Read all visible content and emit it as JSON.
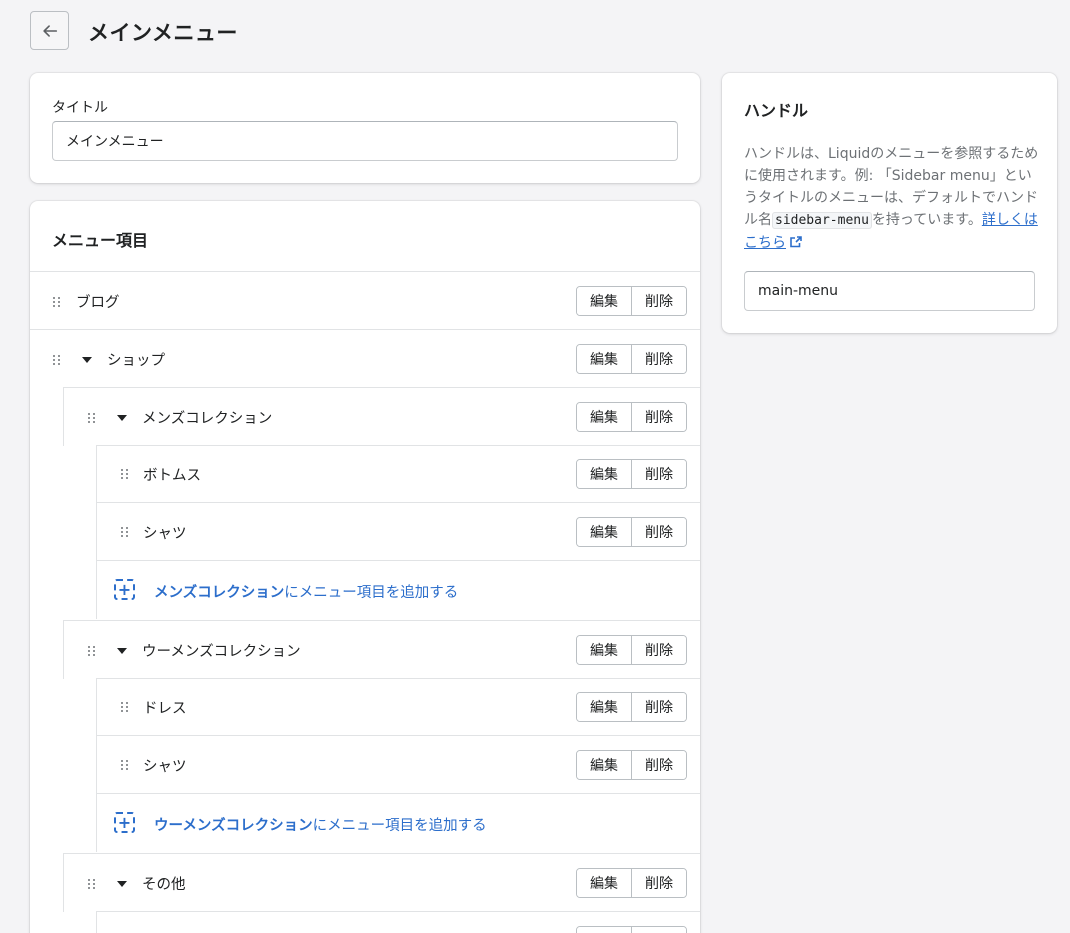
{
  "page": {
    "title": "メインメニュー"
  },
  "title_card": {
    "label": "タイトル",
    "value": "メインメニュー"
  },
  "menu_card": {
    "heading": "メニュー項目",
    "edit_label": "編集",
    "delete_label": "削除",
    "items": {
      "blog": "ブログ",
      "shop": "ショップ",
      "mens": "メンズコレクション",
      "mens_bottoms": "ボトムス",
      "mens_shirts": "シャツ",
      "mens_add_target": "メンズコレクション",
      "mens_add_suffix": "にメニュー項目を追加する",
      "womens": "ウーメンズコレクション",
      "womens_dress": "ドレス",
      "womens_shirts": "シャツ",
      "womens_add_target": "ウーメンズコレクション",
      "womens_add_suffix": "にメニュー項目を追加する",
      "other": "その他"
    }
  },
  "handle_card": {
    "heading": "ハンドル",
    "desc_1": "ハンドルは、Liquidのメニューを参照するために使用されます。例: 「Sidebar menu」というタイトルのメニューは、デフォルトでハンドル名",
    "desc_code": "sidebar-menu",
    "desc_2": "を持っています。",
    "link": "詳しくはこちら",
    "value": "main-menu"
  },
  "colors": {
    "link": "#2c6ecb",
    "text": "#202223",
    "muted": "#6d7175",
    "border": "#e1e3e5"
  }
}
